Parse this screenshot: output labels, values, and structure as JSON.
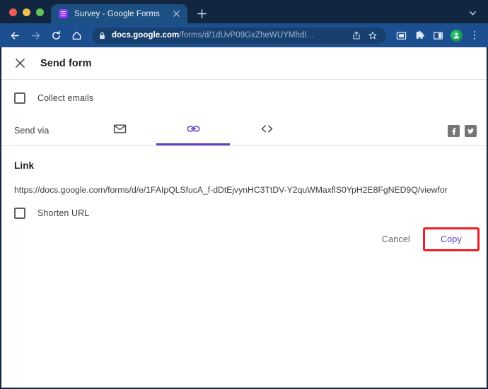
{
  "browser": {
    "window_controls": [
      "close",
      "minimize",
      "maximize"
    ],
    "tab": {
      "title": "Survey - Google Forms",
      "favicon": "google-forms-icon",
      "close_label": "×"
    },
    "new_tab_label": "+",
    "tab_list_icon": "chevron-down-icon",
    "nav": {
      "back_icon": "back-arrow-icon",
      "forward_icon": "forward-arrow-icon",
      "reload_icon": "reload-icon",
      "home_icon": "home-icon"
    },
    "omnibox": {
      "lock_icon": "lock-icon",
      "host": "docs.google.com",
      "path": "/forms/d/1dUvP09GxZheWUYMhdl…",
      "share_icon": "share-icon",
      "bookmark_icon": "star-icon"
    },
    "toolbar_icons": [
      "screenshot-extension-icon",
      "extensions-puzzle-icon",
      "side-panel-icon",
      "profile-avatar-icon",
      "three-dot-menu-icon"
    ]
  },
  "dialog": {
    "close_icon": "close-icon",
    "title": "Send form",
    "collect_emails": {
      "label": "Collect emails",
      "checked": false
    },
    "send_via": {
      "label": "Send via",
      "tabs": [
        {
          "id": "email",
          "icon": "envelope-icon",
          "active": false
        },
        {
          "id": "link",
          "icon": "link-chain-icon",
          "active": true
        },
        {
          "id": "embed",
          "icon": "embed-code-icon",
          "active": false
        }
      ]
    },
    "social": [
      {
        "id": "facebook",
        "icon": "facebook-icon"
      },
      {
        "id": "twitter",
        "icon": "twitter-icon"
      }
    ],
    "link_section": {
      "title": "Link",
      "url": "https://docs.google.com/forms/d/e/1FAIpQLSfucA_f-dDtEjvynHC3TtDV-Y2quWMaxflS0YpH2E8FgNED9Q/viewfor",
      "shorten": {
        "label": "Shorten URL",
        "checked": false
      }
    },
    "actions": {
      "cancel_label": "Cancel",
      "copy_label": "Copy"
    }
  },
  "annotation": {
    "highlight_color": "#ee1c25",
    "target": "copy-button"
  },
  "colors": {
    "titlebar": "#12263f",
    "active_tab": "#1c4f82",
    "toolbar": "#1b4f8f",
    "omnibox": "#18406f",
    "accent_purple": "#5f3dc4",
    "highlight_red": "#ee1c25"
  }
}
